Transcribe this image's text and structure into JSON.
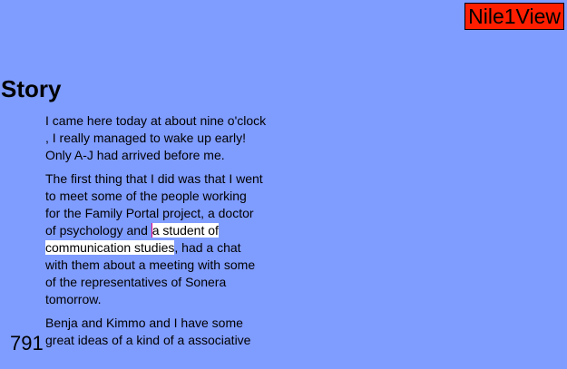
{
  "header": {
    "brand": "Nile1View"
  },
  "page": {
    "title": "Story",
    "number": "791"
  },
  "story": {
    "p1": [
      "I came here today at about nine o'clock",
      ", I really managed to wake up early!",
      "Only A-J had arrived before me."
    ],
    "p2": {
      "lines_before": [
        "The first thing that I did was that I went",
        "to meet some of the people working",
        "for the Family Portal project, a doctor"
      ],
      "sel_line_prefix": "of psychology and ",
      "selected_part1": "a student of ",
      "selected_part2": "communication studies",
      "sel_line_suffix": ", had a chat",
      "lines_after": [
        "with them about a meeting with some",
        "of the representatives of Sonera",
        "tomorrow."
      ]
    },
    "p3": [
      "Benja and Kimmo and I have some",
      "great ideas of a kind of a associative"
    ]
  },
  "colors": {
    "background": "#7f9cff",
    "brand_bg": "#ff1f00",
    "selection": "#ffffff",
    "caret": "#e4007f"
  }
}
